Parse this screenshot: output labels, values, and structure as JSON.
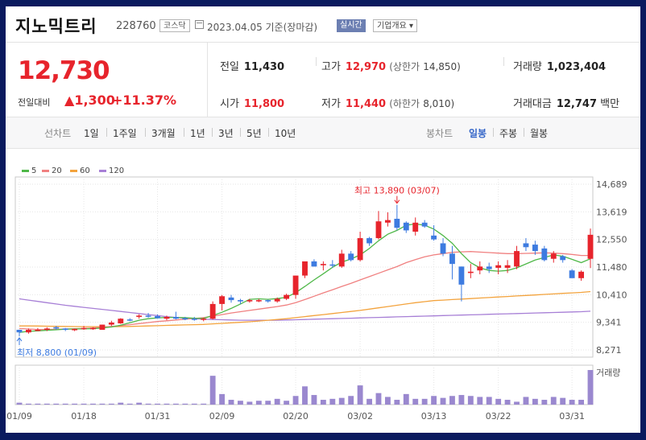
{
  "header": {
    "stock_name": "지노믹트리",
    "stock_code": "228760",
    "market_tag": "코스닥",
    "date_text": "2023.04.05 기준(장마감)",
    "realtime_tag": "실시간",
    "company_info_tag": "기업개요 ▾"
  },
  "price": {
    "current": "12,730",
    "change_label": "전일대비",
    "change_arrow": "▲",
    "change": "1,300",
    "change_pct": "+11.37%"
  },
  "stats": {
    "prev_close_label": "전일",
    "prev_close": "11,430",
    "high_label": "고가",
    "high": "12,970",
    "upper_limit_label": "(상한가",
    "upper_limit": "14,850)",
    "volume_label": "거래량",
    "volume": "1,023,404",
    "open_label": "시가",
    "open": "11,800",
    "low_label": "저가",
    "low": "11,440",
    "lower_limit_label": "(하한가",
    "lower_limit": "8,010)",
    "trade_value_label": "거래대금",
    "trade_value": "12,747",
    "trade_value_unit": "백만"
  },
  "period_tabs": {
    "line_chart": "선차트",
    "items": [
      "1일",
      "1주일",
      "3개월",
      "1년",
      "3년",
      "5년",
      "10년"
    ],
    "candle_chart": "봉차트",
    "candle_items": [
      "일봉",
      "주봉",
      "월봉"
    ],
    "active_candle": "일봉"
  },
  "colors": {
    "up": "#e7242c",
    "down": "#3d7be0",
    "ma5": "#4fb848",
    "ma20": "#f08080",
    "ma60": "#f3a33d",
    "ma120": "#a77fd6",
    "volume": "#9a88cf"
  },
  "chart_data": {
    "type": "candlestick",
    "legend": [
      {
        "name": "5",
        "color": "#4fb848"
      },
      {
        "name": "20",
        "color": "#f08080"
      },
      {
        "name": "60",
        "color": "#f3a33d"
      },
      {
        "name": "120",
        "color": "#a77fd6"
      }
    ],
    "y_ticks": [
      14689,
      13619,
      12550,
      11480,
      10410,
      9341,
      8271
    ],
    "y_tick_labels": [
      "14,689",
      "13,619",
      "12,550",
      "11,480",
      "10,410",
      "9,341",
      "8,271"
    ],
    "ylim": [
      8271,
      14689
    ],
    "x_tick_labels": [
      "01/09",
      "01/18",
      "01/31",
      "02/09",
      "02/20",
      "03/02",
      "03/13",
      "03/22",
      "03/31"
    ],
    "x_tick_index": [
      0,
      7,
      15,
      22,
      30,
      37,
      45,
      52,
      60
    ],
    "annotations": {
      "high_label": "최고 13,890 (03/07)",
      "high_value": 13890,
      "high_index": 41,
      "low_label": "최저 8,800 (01/09)",
      "low_value": 8800,
      "low_index": 0
    },
    "volume_label": "거래량",
    "candles": [
      [
        9050,
        9050,
        8800,
        8950
      ],
      [
        8950,
        9100,
        8900,
        9050
      ],
      [
        9050,
        9120,
        9000,
        9050
      ],
      [
        9050,
        9150,
        9000,
        9100
      ],
      [
        9150,
        9200,
        9050,
        9100
      ],
      [
        9100,
        9120,
        9000,
        9050
      ],
      [
        9050,
        9100,
        9000,
        9080
      ],
      [
        9080,
        9200,
        9050,
        9120
      ],
      [
        9100,
        9150,
        9050,
        9120
      ],
      [
        9050,
        9250,
        9050,
        9250
      ],
      [
        9250,
        9400,
        9200,
        9330
      ],
      [
        9300,
        9500,
        9280,
        9480
      ],
      [
        9450,
        9500,
        9380,
        9420
      ],
      [
        9550,
        9650,
        9480,
        9600
      ],
      [
        9600,
        9700,
        9520,
        9580
      ],
      [
        9580,
        9650,
        9480,
        9500
      ],
      [
        9480,
        9600,
        9420,
        9550
      ],
      [
        9550,
        9750,
        9450,
        9480
      ],
      [
        9500,
        9550,
        9420,
        9480
      ],
      [
        9480,
        9550,
        9400,
        9450
      ],
      [
        9450,
        9520,
        9380,
        9480
      ],
      [
        9480,
        10150,
        9450,
        10050
      ],
      [
        10050,
        10400,
        9800,
        10350
      ],
      [
        10300,
        10400,
        10100,
        10200
      ],
      [
        10200,
        10250,
        10050,
        10150
      ],
      [
        10150,
        10250,
        10100,
        10200
      ],
      [
        10150,
        10250,
        10120,
        10200
      ],
      [
        10200,
        10220,
        10100,
        10150
      ],
      [
        10150,
        10300,
        10100,
        10250
      ],
      [
        10250,
        10450,
        10200,
        10400
      ],
      [
        10400,
        11150,
        10250,
        11150
      ],
      [
        11150,
        11700,
        11050,
        11700
      ],
      [
        11700,
        11780,
        11500,
        11500
      ],
      [
        11550,
        11700,
        11350,
        11600
      ],
      [
        11580,
        11750,
        11450,
        11550
      ],
      [
        11500,
        12150,
        11450,
        12000
      ],
      [
        12000,
        12100,
        11700,
        11750
      ],
      [
        11750,
        12850,
        11700,
        12600
      ],
      [
        12600,
        12650,
        12300,
        12400
      ],
      [
        12600,
        13650,
        12550,
        13250
      ],
      [
        13200,
        13600,
        13050,
        13300
      ],
      [
        13350,
        13890,
        12900,
        13000
      ],
      [
        13200,
        13250,
        12800,
        12900
      ],
      [
        12850,
        13400,
        12700,
        13200
      ],
      [
        13200,
        13300,
        13000,
        13050
      ],
      [
        12700,
        13100,
        12500,
        12550
      ],
      [
        12400,
        12600,
        11900,
        12000
      ],
      [
        12000,
        12300,
        11000,
        11600
      ],
      [
        11500,
        11500,
        10150,
        10800
      ],
      [
        11250,
        11600,
        11050,
        11300
      ],
      [
        11350,
        11700,
        11200,
        11500
      ],
      [
        11500,
        11650,
        11250,
        11400
      ],
      [
        11450,
        11700,
        11200,
        11550
      ],
      [
        11450,
        11750,
        11250,
        11550
      ],
      [
        11500,
        12300,
        11400,
        12100
      ],
      [
        12400,
        12600,
        12100,
        12250
      ],
      [
        12350,
        12500,
        11950,
        12100
      ],
      [
        12200,
        12300,
        11700,
        11750
      ],
      [
        11800,
        12100,
        11650,
        12000
      ],
      [
        11900,
        11950,
        11650,
        11750
      ],
      [
        11350,
        11400,
        11100,
        11050
      ],
      [
        11050,
        11350,
        10950,
        11300
      ],
      [
        11800,
        12970,
        11440,
        12730
      ]
    ],
    "ma5": [
      8950,
      8990,
      9010,
      9030,
      9050,
      9075,
      9080,
      9090,
      9095,
      9120,
      9160,
      9230,
      9320,
      9420,
      9480,
      9510,
      9530,
      9530,
      9520,
      9500,
      9490,
      9600,
      9730,
      9880,
      10050,
      10230,
      10250,
      10230,
      10260,
      10310,
      10490,
      10730,
      10980,
      11220,
      11470,
      11670,
      11790,
      11950,
      12200,
      12500,
      12750,
      12900,
      13100,
      13150,
      13100,
      12950,
      12700,
      12400,
      12000,
      11650,
      11450,
      11350,
      11320,
      11350,
      11450,
      11600,
      11750,
      11850,
      11950,
      11900,
      11780,
      11650,
      11800
    ],
    "ma20": [
      9100,
      9080,
      9060,
      9060,
      9070,
      9080,
      9090,
      9100,
      9120,
      9150,
      9180,
      9210,
      9250,
      9290,
      9330,
      9370,
      9400,
      9430,
      9460,
      9490,
      9520,
      9580,
      9640,
      9700,
      9750,
      9800,
      9850,
      9900,
      9950,
      10010,
      10100,
      10220,
      10350,
      10480,
      10600,
      10730,
      10850,
      10980,
      11110,
      11240,
      11370,
      11500,
      11650,
      11770,
      11880,
      11950,
      12000,
      12050,
      12070,
      12080,
      12060,
      12040,
      12020,
      12000,
      12000,
      12010,
      12020,
      12030,
      12020,
      12000,
      11970,
      11930,
      11930
    ],
    "ma60": [
      9200,
      9200,
      9195,
      9190,
      9185,
      9180,
      9175,
      9170,
      9170,
      9170,
      9170,
      9175,
      9180,
      9190,
      9200,
      9210,
      9220,
      9230,
      9240,
      9250,
      9260,
      9280,
      9300,
      9320,
      9340,
      9360,
      9390,
      9420,
      9450,
      9480,
      9520,
      9560,
      9600,
      9640,
      9680,
      9720,
      9760,
      9800,
      9850,
      9900,
      9950,
      10000,
      10050,
      10100,
      10140,
      10180,
      10200,
      10220,
      10240,
      10260,
      10280,
      10300,
      10320,
      10340,
      10360,
      10380,
      10400,
      10420,
      10440,
      10460,
      10480,
      10500,
      10530
    ],
    "ma120": [
      10250,
      10200,
      10150,
      10100,
      10050,
      10000,
      9960,
      9920,
      9880,
      9840,
      9800,
      9760,
      9720,
      9680,
      9640,
      9600,
      9560,
      9530,
      9500,
      9480,
      9460,
      9450,
      9440,
      9430,
      9420,
      9420,
      9420,
      9420,
      9420,
      9430,
      9440,
      9450,
      9460,
      9470,
      9480,
      9490,
      9500,
      9510,
      9520,
      9530,
      9540,
      9550,
      9560,
      9570,
      9580,
      9590,
      9600,
      9610,
      9620,
      9630,
      9640,
      9650,
      9660,
      9670,
      9680,
      9690,
      9700,
      9710,
      9720,
      9730,
      9740,
      9750,
      9770
    ],
    "volume": [
      2,
      1,
      1,
      1,
      1,
      1,
      1,
      1,
      1,
      1,
      1,
      2,
      1,
      2,
      1,
      1,
      1,
      1,
      1,
      1,
      1,
      30,
      11,
      5,
      4,
      3,
      4,
      4,
      6,
      4,
      9,
      19,
      10,
      5,
      6,
      7,
      9,
      20,
      6,
      12,
      8,
      5,
      11,
      6,
      6,
      9,
      7,
      9,
      10,
      9,
      8,
      8,
      6,
      5,
      3,
      8,
      6,
      5,
      8,
      7,
      5,
      5,
      36
    ]
  }
}
